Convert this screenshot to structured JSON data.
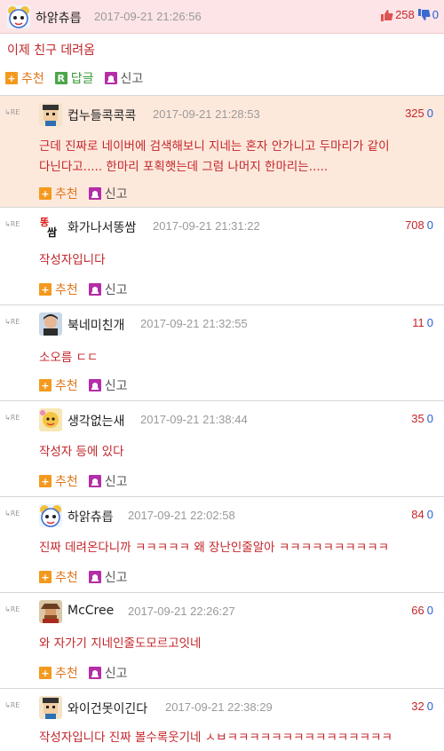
{
  "post": {
    "nickname": "하앍츄릅",
    "date": "2017-09-21 21:26:56",
    "upvotes": "258",
    "downvotes": "0",
    "body": "이제 친구 데려옴",
    "actions": {
      "recommend": "추천",
      "reply": "답글",
      "report": "신고"
    },
    "reply_icon_letter": "R",
    "recommend_icon_char": "+"
  },
  "re_label": "RE",
  "comments": [
    {
      "nickname": "컵누들콕콕콕",
      "date": "2017-09-21 21:28:53",
      "upvotes": "325",
      "downvotes": "0",
      "body_lines": [
        "근데 진짜로 네이버에 검색해보니 지네는 혼자 안가니고 두마리가 같이",
        "다닌다고..... 한마리 포획햇는데 그럼 나머지 한마리는....."
      ],
      "recommend": "추천",
      "report": "신고"
    },
    {
      "nickname": "화가나서똥쌈",
      "date": "2017-09-21 21:31:22",
      "upvotes": "708",
      "downvotes": "0",
      "body_lines": [
        "작성자입니다"
      ],
      "recommend": "추천",
      "report": "신고"
    },
    {
      "nickname": "북네미친개",
      "date": "2017-09-21 21:32:55",
      "upvotes": "11",
      "downvotes": "0",
      "body_lines": [
        "소오름 ㄷㄷ"
      ],
      "recommend": "추천",
      "report": "신고"
    },
    {
      "nickname": "생각없는새",
      "date": "2017-09-21 21:38:44",
      "upvotes": "35",
      "downvotes": "0",
      "body_lines": [
        "작성자 등에 있다"
      ],
      "recommend": "추천",
      "report": "신고"
    },
    {
      "nickname": "하앍츄릅",
      "date": "2017-09-21 22:02:58",
      "upvotes": "84",
      "downvotes": "0",
      "body_lines": [
        "진짜 데려온다니까 ㅋㅋㅋㅋㅋ 왜 장난인줄알아 ㅋㅋㅋㅋㅋㅋㅋㅋㅋㅋ"
      ],
      "recommend": "추천",
      "report": "신고"
    },
    {
      "nickname": "McCree",
      "date": "2017-09-21 22:26:27",
      "upvotes": "66",
      "downvotes": "0",
      "body_lines": [
        "와 자가기 지네인줄도모르고잇네"
      ],
      "recommend": "추천",
      "report": "신고"
    },
    {
      "nickname": "와이건못이긴다",
      "date": "2017-09-21 22:38:29",
      "upvotes": "32",
      "downvotes": "0",
      "body_lines": [
        "작성자입니다 진짜 볼수록웃기네 ㅅㅂㅋㅋㅋㅋㅋㅋㅋㅋㅋㅋㅋㅋㅋㅋㅋ"
      ],
      "recommend": "추천",
      "report": "신고"
    }
  ],
  "colors": {
    "header_bg": "#fde4e6",
    "highlight_bg": "#fde9dc",
    "accent_red": "#c3262b",
    "down_blue": "#2a5bd7"
  }
}
